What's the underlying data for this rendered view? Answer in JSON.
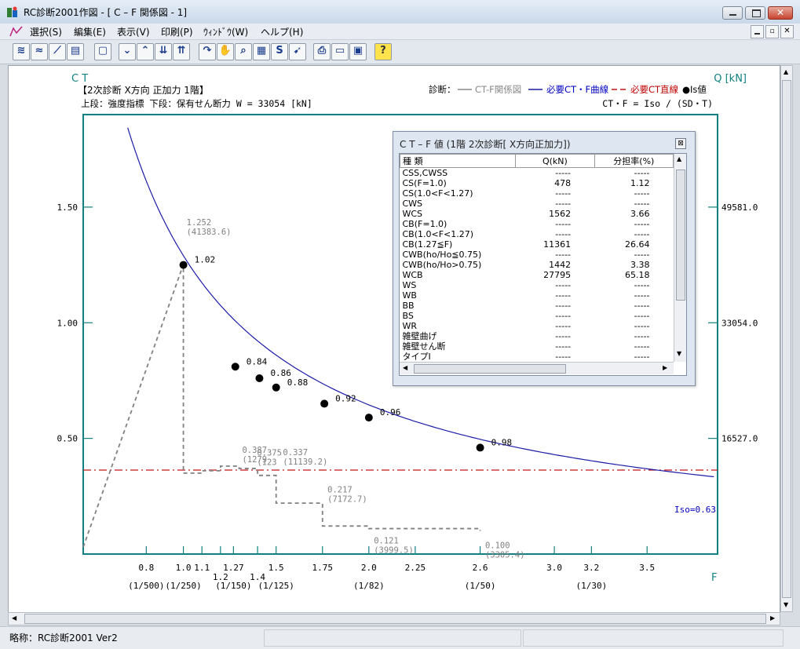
{
  "window": {
    "title": "RC診断2001作図 - [ C – F 関係図 - 1]"
  },
  "menu": [
    {
      "label": "選択(S)"
    },
    {
      "label": "編集(E)"
    },
    {
      "label": "表示(V)"
    },
    {
      "label": "印刷(P)"
    },
    {
      "label": "ｳｨﾝﾄﾞｳ(W)"
    },
    {
      "label": "ヘルプ(H)"
    }
  ],
  "toolbar": {
    "icons": [
      "ct-f-icon",
      "ct-f2-icon",
      "graph-icon",
      "table-icon",
      "document-icon",
      "chevron-down-icon",
      "chevron-up-icon",
      "double-chevron-down-icon",
      "double-chevron-up-icon",
      "redo-icon",
      "hand-icon",
      "zoom-icon",
      "grid-icon",
      "s-icon",
      "arrow-icon",
      "print-icon",
      "preview-icon",
      "setup-icon",
      "help-icon"
    ]
  },
  "chart_header": {
    "ct_label": "C T",
    "q_label": "Q [kN]",
    "line1": "【2次診断  X方向  正加力  1階】",
    "line2": "上段：強度指標  下段：保有せん断力   W = 33054 [kN]",
    "legend_prefix": "診断：",
    "legend_ctf": "CT-F関係図",
    "legend_curve": "必要CT・F曲線",
    "legend_line": "必要CT直線",
    "legend_is": "●Is値",
    "formula": "CT・F = Iso / (SD・T)",
    "f_label": "F",
    "iso_label": "Iso=0.63"
  },
  "chart_data": {
    "type": "scatter",
    "y_left_ticks": [
      {
        "v": 0.5,
        "label": "0.50"
      },
      {
        "v": 1.0,
        "label": "1.00"
      },
      {
        "v": 1.5,
        "label": "1.50"
      }
    ],
    "y_right_ticks": [
      {
        "v": 0.5,
        "label": "16527.0"
      },
      {
        "v": 1.0,
        "label": "33054.0"
      },
      {
        "v": 1.5,
        "label": "49581.0"
      }
    ],
    "x_ticks_row1": [
      {
        "v": 0.8,
        "label": "0.8"
      },
      {
        "v": 1.0,
        "label": "1.0"
      },
      {
        "v": 1.1,
        "label": "1.1"
      },
      {
        "v": 1.27,
        "label": "1.27"
      },
      {
        "v": 1.5,
        "label": "1.5"
      },
      {
        "v": 1.75,
        "label": "1.75"
      },
      {
        "v": 2.0,
        "label": "2.0"
      },
      {
        "v": 2.25,
        "label": "2.25"
      },
      {
        "v": 2.6,
        "label": "2.6"
      },
      {
        "v": 3.0,
        "label": "3.0"
      },
      {
        "v": 3.2,
        "label": "3.2"
      },
      {
        "v": 3.5,
        "label": "3.5"
      }
    ],
    "x_ticks_row2": [
      {
        "v": 1.2,
        "label": "1.2"
      },
      {
        "v": 1.4,
        "label": "1.4"
      }
    ],
    "x_ticks_row3": [
      {
        "v": 0.8,
        "label": "(1/500)"
      },
      {
        "v": 1.0,
        "label": "(1/250)"
      },
      {
        "v": 1.27,
        "label": "(1/150)"
      },
      {
        "v": 1.5,
        "label": "(1/125)"
      },
      {
        "v": 2.0,
        "label": "(1/82)"
      },
      {
        "v": 2.6,
        "label": "(1/50)"
      },
      {
        "v": 3.2,
        "label": "(1/30)"
      }
    ],
    "required_ct_value": 0.363,
    "iso": 0.63,
    "ctf_step_points": [
      {
        "x": 0.46,
        "y": 0.03
      },
      {
        "x": 1.0,
        "y": 1.252
      },
      {
        "x": 1.0,
        "y": 0.35
      },
      {
        "x": 1.1,
        "y": 0.36
      },
      {
        "x": 1.2,
        "y": 0.38
      },
      {
        "x": 1.3,
        "y": 0.37
      },
      {
        "x": 1.4,
        "y": 0.34
      },
      {
        "x": 1.5,
        "y": 0.22
      },
      {
        "x": 1.75,
        "y": 0.121
      },
      {
        "x": 2.0,
        "y": 0.11
      },
      {
        "x": 2.6,
        "y": 0.1
      }
    ],
    "annotations": [
      {
        "x": 1.0,
        "y": 1.252,
        "dy": -0.17,
        "text": "1.252",
        "sub": "(41383.6)"
      },
      {
        "x": 1.3,
        "y": 0.387,
        "dy": -0.05,
        "text": "0.387",
        "sub": "(1279"
      },
      {
        "x": 1.38,
        "y": 0.375,
        "dy": -0.05,
        "text": "0.375",
        "sub": "(123"
      },
      {
        "x": 1.52,
        "y": 0.337,
        "dy": -0.09,
        "text": "0.337",
        "sub": "(11139.2)"
      },
      {
        "x": 1.76,
        "y": 0.217,
        "dy": -0.05,
        "text": "0.217",
        "sub": "(7172.7)"
      },
      {
        "x": 2.01,
        "y": 0.121,
        "dy": -0.0,
        "text": "0.121",
        "sub": "(3999.5)"
      },
      {
        "x": 2.61,
        "y": 0.1,
        "dy": -0.0,
        "text": "0.100",
        "sub": "(3305.4)"
      }
    ],
    "is_points": [
      {
        "x": 1.0,
        "y": 1.25,
        "label": "1.02"
      },
      {
        "x": 1.28,
        "y": 0.81,
        "label": "0.84"
      },
      {
        "x": 1.41,
        "y": 0.76,
        "label": "0.86"
      },
      {
        "x": 1.5,
        "y": 0.72,
        "label": "0.88"
      },
      {
        "x": 1.76,
        "y": 0.65,
        "label": "0.92"
      },
      {
        "x": 2.0,
        "y": 0.59,
        "label": "0.96"
      },
      {
        "x": 2.6,
        "y": 0.46,
        "label": "0.98"
      }
    ]
  },
  "ctf_table": {
    "title": "C T – F 値  (1階 2次診断[ X方向正加力])",
    "headers": [
      "種   類",
      "Q(kN)",
      "分担率(%)"
    ],
    "rows": [
      [
        "CSS,CWSS",
        "-----",
        "-----"
      ],
      [
        "CS(F=1.0)",
        "478",
        "1.12"
      ],
      [
        "CS(1.0<F<1.27)",
        "-----",
        "-----"
      ],
      [
        "CWS",
        "-----",
        "-----"
      ],
      [
        "WCS",
        "1562",
        "3.66"
      ],
      [
        "CB(F=1.0)",
        "-----",
        "-----"
      ],
      [
        "CB(1.0<F<1.27)",
        "-----",
        "-----"
      ],
      [
        "CB(1.27≦F)",
        "11361",
        "26.64"
      ],
      [
        "CWB(ho/Ho≦0.75)",
        "-----",
        "-----"
      ],
      [
        "CWB(ho/Ho>0.75)",
        "1442",
        "3.38"
      ],
      [
        "WCB",
        "27795",
        "65.18"
      ],
      [
        "WS",
        "-----",
        "-----"
      ],
      [
        "WB",
        "-----",
        "-----"
      ],
      [
        "BB",
        "-----",
        "-----"
      ],
      [
        "BS",
        "-----",
        "-----"
      ],
      [
        "WR",
        "-----",
        "-----"
      ],
      [
        "雑壁曲げ",
        "-----",
        "-----"
      ],
      [
        "雑壁せん断",
        "-----",
        "-----"
      ],
      [
        "タイプⅠ",
        "-----",
        "-----"
      ]
    ]
  },
  "status": {
    "text": "略称：RC診断2001 Ver2"
  },
  "colors": {
    "axis": "#108080",
    "curve": "#1c1ca8",
    "required_line": "#c01818",
    "step": "#808080",
    "accent_blue": "#0000c0",
    "accent_red": "#c00000"
  }
}
